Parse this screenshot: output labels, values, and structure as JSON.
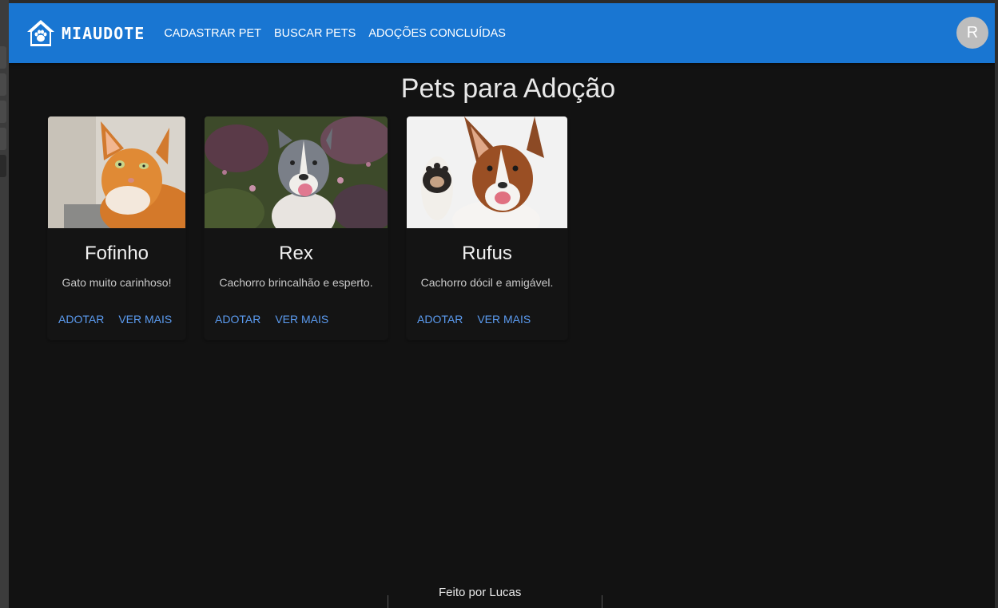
{
  "app": {
    "brand": "MIAUDOTE",
    "nav": [
      "CADASTRAR PET",
      "BUSCAR PETS",
      "ADOÇÕES CONCLUÍDAS"
    ],
    "avatar_letter": "R",
    "accent": "#1976d2"
  },
  "main": {
    "title": "Pets para Adoção",
    "pets": [
      {
        "name": "Fofinho",
        "description": "Gato muito carinhoso!",
        "adopt_label": "ADOTAR",
        "more_label": "VER MAIS",
        "image": "orange-cat-photo"
      },
      {
        "name": "Rex",
        "description": "Cachorro brincalhão e esperto.",
        "adopt_label": "ADOTAR",
        "more_label": "VER MAIS",
        "image": "pitbull-dog-photo"
      },
      {
        "name": "Rufus",
        "description": "Cachorro dócil e amigável.",
        "adopt_label": "ADOTAR",
        "more_label": "VER MAIS",
        "image": "waving-dog-photo"
      }
    ]
  },
  "footer": {
    "text": "Feito por Lucas"
  }
}
